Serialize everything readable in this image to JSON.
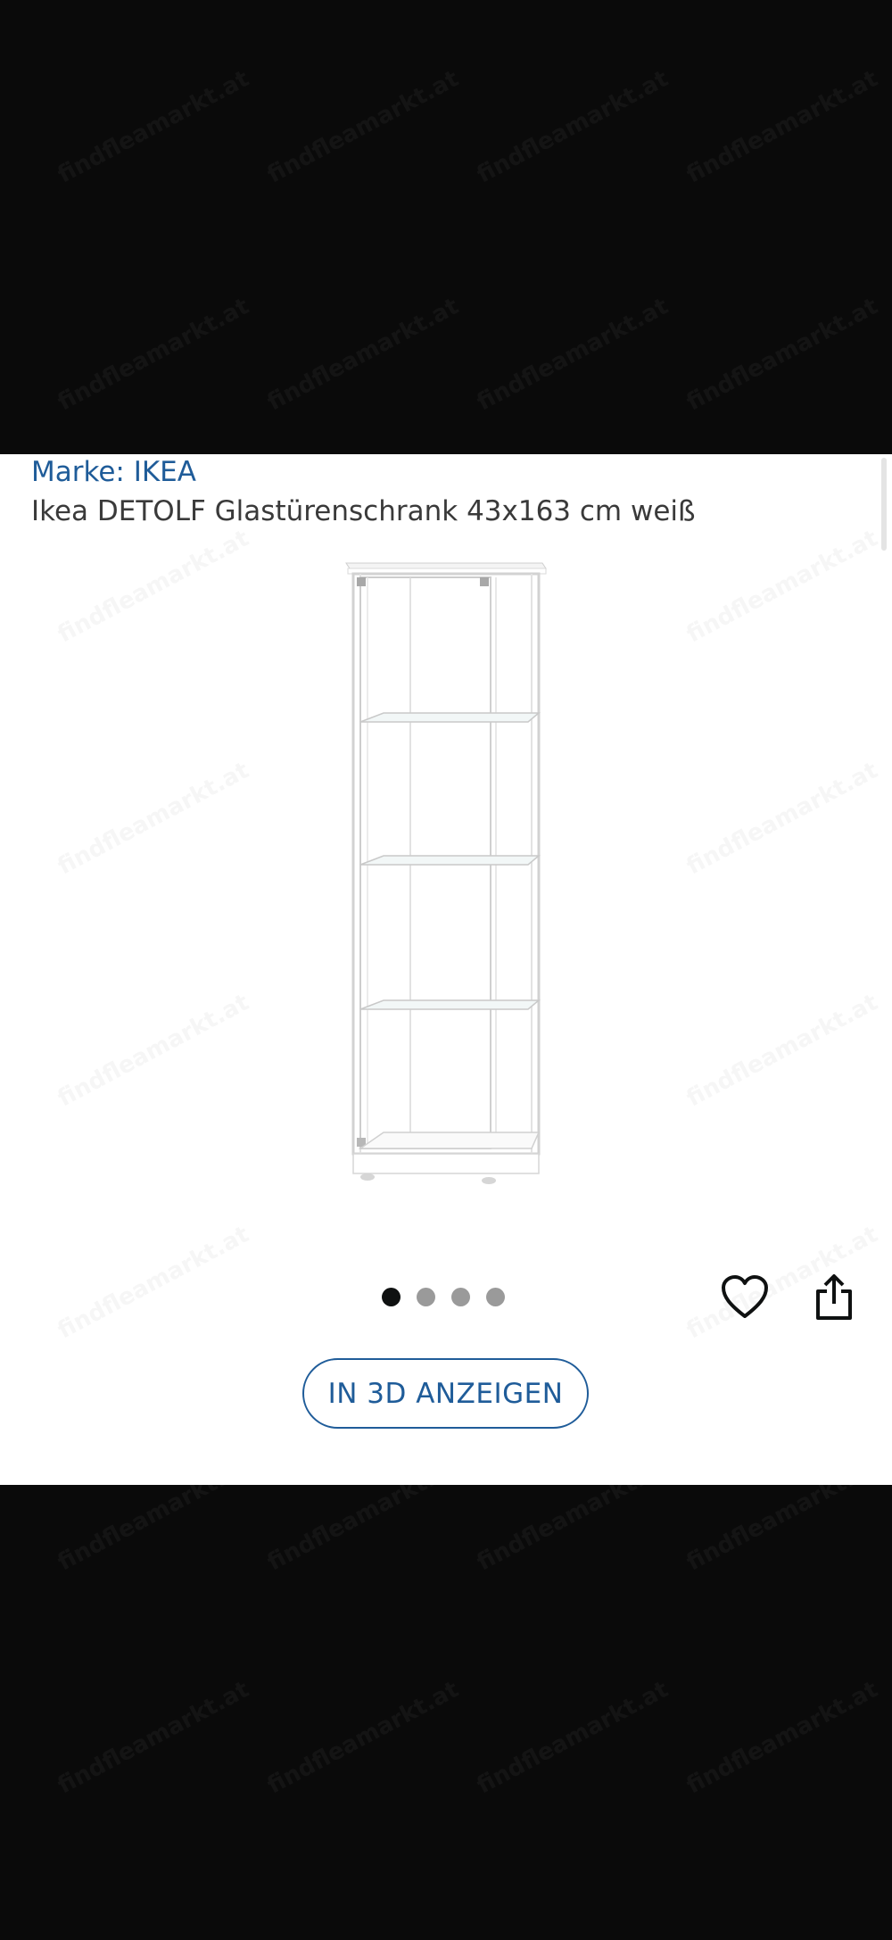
{
  "product": {
    "brand_label": "Marke: IKEA",
    "title": "Ikea DETOLF Glastürenschrank 43x163 cm weiß"
  },
  "gallery": {
    "image_count": 4,
    "active_index": 0
  },
  "actions": {
    "view_3d_label": "IN 3D ANZEIGEN",
    "favorite_icon": "heart-icon",
    "share_icon": "share-icon"
  },
  "watermark": {
    "text": "findfleamarkt.at"
  },
  "colors": {
    "accent": "#1f5c99",
    "title_text": "#3a3a3a",
    "background_outer": "#0a0a0a",
    "panel": "#ffffff",
    "dot_active": "#0f1111",
    "dot_inactive": "#9a9a9a"
  }
}
